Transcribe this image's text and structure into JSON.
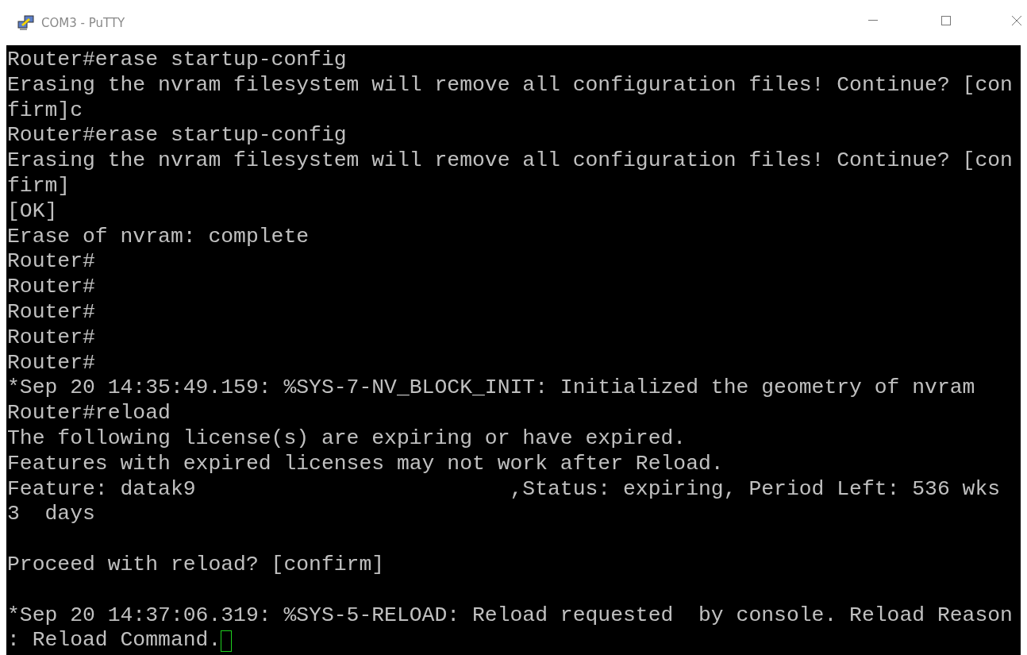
{
  "window": {
    "title": "COM3 - PuTTY"
  },
  "terminal": {
    "blocks": [
      [
        "Router#erase startup-config",
        "Erasing the nvram filesystem will remove all configuration files! Continue? [con",
        "firm]c",
        "Router#erase startup-config",
        "Erasing the nvram filesystem will remove all configuration files! Continue? [con",
        "firm]",
        "[OK]",
        "Erase of nvram: complete",
        "Router#",
        "Router#",
        "Router#",
        "Router#",
        "Router#",
        "*Sep 20 14:35:49.159: %SYS-7-NV_BLOCK_INIT: Initialized the geometry of nvram",
        "Router#reload",
        "The following license(s) are expiring or have expired.",
        "Features with expired licenses may not work after Reload.",
        "Feature: datak9                         ,Status: expiring, Period Left: 536 wks",
        "3  days"
      ],
      [
        "Proceed with reload? [confirm]"
      ],
      [
        "*Sep 20 14:37:06.319: %SYS-5-RELOAD: Reload requested  by console. Reload Reason",
        ": Reload Command."
      ]
    ]
  }
}
